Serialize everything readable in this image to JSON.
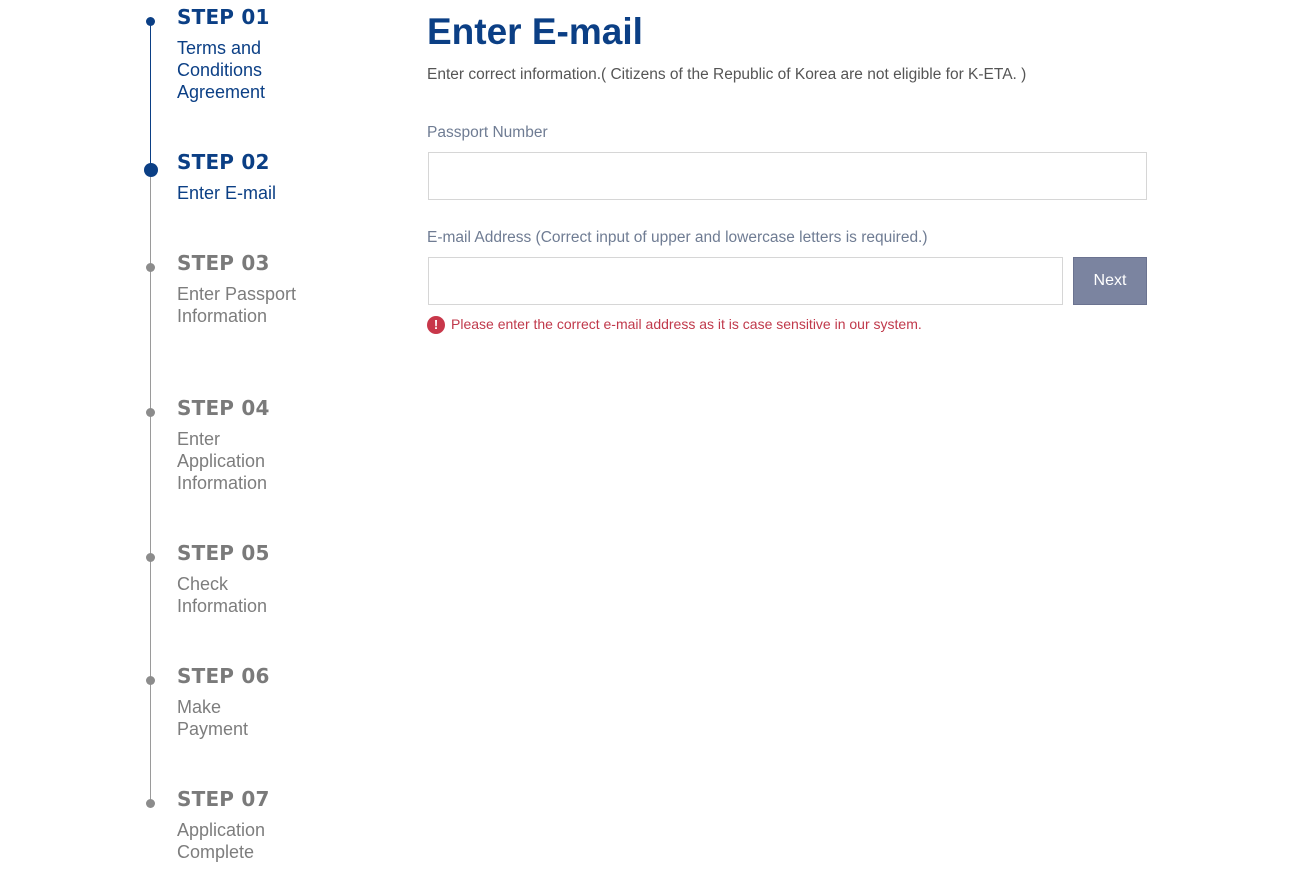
{
  "stepper": {
    "steps": [
      {
        "number": "STEP 01",
        "label": "Terms and Conditions Agreement",
        "status": "done"
      },
      {
        "number": "STEP 02",
        "label": "Enter E-mail",
        "status": "current"
      },
      {
        "number": "STEP 03",
        "label": "Enter Passport Information",
        "status": "todo"
      },
      {
        "number": "STEP 04",
        "label": "Enter Application Information",
        "status": "todo"
      },
      {
        "number": "STEP 05",
        "label": "Check Information",
        "status": "todo"
      },
      {
        "number": "STEP 06",
        "label": "Make Payment",
        "status": "todo"
      },
      {
        "number": "STEP 07",
        "label": "Application Complete",
        "status": "todo"
      }
    ]
  },
  "main": {
    "title": "Enter E-mail",
    "intro": "Enter correct information.( Citizens of the Republic of Korea are not eligible for K-ETA. )",
    "passport": {
      "label": "Passport Number",
      "value": "",
      "placeholder": ""
    },
    "email": {
      "label": "E-mail Address (Correct input of upper and lowercase letters is required.)",
      "value": "",
      "placeholder": ""
    },
    "next_label": "Next",
    "error": {
      "icon": "exclamation-circle-icon",
      "icon_glyph": "!",
      "text": "Please enter the correct e-mail address as it is case sensitive in our system."
    }
  },
  "colors": {
    "primary": "#0b3f85",
    "inactive": "#7a7a7a",
    "button": "#7b84a0",
    "error": "#c0394b",
    "label": "#6f7c93"
  }
}
